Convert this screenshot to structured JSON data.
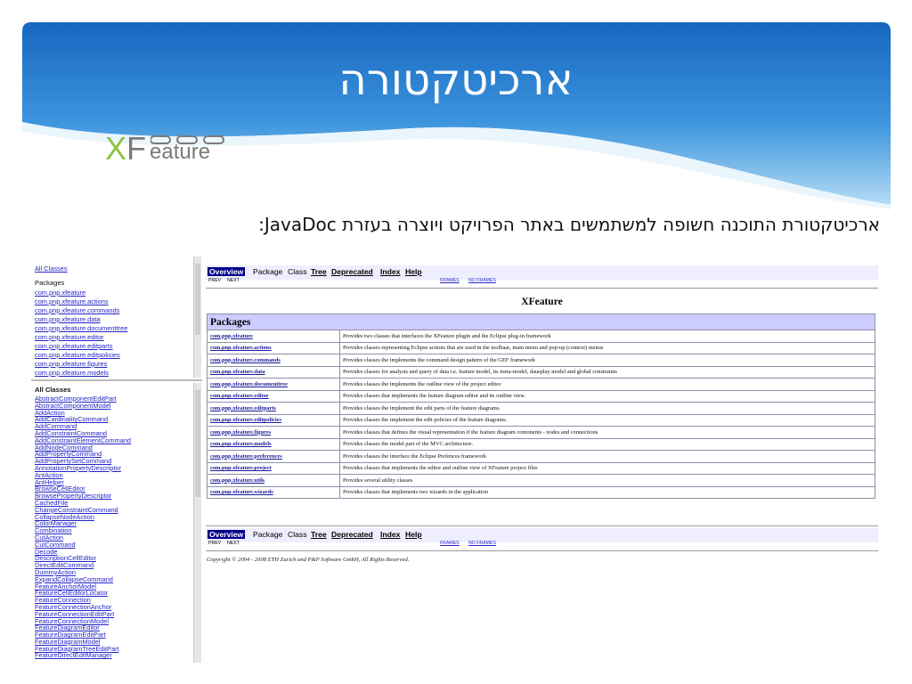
{
  "slide": {
    "title": "ארכיטקטורה",
    "subtitle": "ארכיטקטורת התוכנה חשופה למשתמשים באתר הפרויקט ויוצרה בעזרת JavaDoc:",
    "logo_text": "XFeature",
    "logo_x": "X",
    "logo_f": "F",
    "logo_rest": "eature",
    "colors": {
      "header_top": "#1a6fc4",
      "header_bottom": "#9ccdf0",
      "logo_green": "#8cc63f",
      "logo_gray": "#7a7a7a"
    }
  },
  "packages_frame": {
    "all_classes_link": "All Classes",
    "packages_label": "Packages",
    "items": [
      "com.pnp.xfeature",
      "com.pnp.xfeature.actions",
      "com.pnp.xfeature.commands",
      "com.pnp.xfeature.data",
      "com.pnp.xfeature.documenttree",
      "com.pnp.xfeature.editor",
      "com.pnp.xfeature.editparts",
      "com.pnp.xfeature.editpolicies",
      "com.pnp.xfeature.figures",
      "com.pnp.xfeature.models"
    ]
  },
  "classes_frame": {
    "heading": "All Classes",
    "items": [
      "AbstractComponentEditPart",
      "AbstractComponentModel",
      "AddAction",
      "AddCardinalityCommand",
      "AddCommand",
      "AddConstraintCommand",
      "AddConstraintElementCommand",
      "AddNodeCommand",
      "AddPropertyCommand",
      "AddPropertySetCommand",
      "AnnotationPropertyDescriptor",
      "AntAction",
      "AntHelper",
      "BrowseCellEditor",
      "BrowsePropertyDescriptor",
      "CachedFile",
      "ChangeConstraintCommand",
      "CollapseNodeAction",
      "ColorManager",
      "Combination",
      "CutAction",
      "CutCommand",
      "Decode",
      "DescriptionCellEditor",
      "DirectEditCommand",
      "DummyAction",
      "ExpandCollapseCommand",
      "FeatureAnchorModel",
      "FeatureCellEditorLocator",
      "FeatureConnection",
      "FeatureConnectionAnchor",
      "FeatureConnectionEditPart",
      "FeatureConnectionModel",
      "FeatureDiagramEditor",
      "FeatureDiagramEditPart",
      "FeatureDiagramModel",
      "FeatureDiagramTreeEditPart",
      "FeatureDirectEditManager"
    ]
  },
  "navbar": {
    "overview": "Overview",
    "package": "Package",
    "class": "Class",
    "tree": "Tree",
    "deprecated": "Deprecated",
    "index": "Index",
    "help": "Help",
    "prev": "PREV",
    "next": "NEXT",
    "frames": "FRAMES",
    "no_frames": "NO FRAMES"
  },
  "overview": {
    "title": "XFeature",
    "table_heading": "Packages",
    "rows": [
      {
        "name": "com.pnp.xfeature",
        "desc": "Provides two classes that interfaces the XFeature plugin and the Eclipse plug-in framework"
      },
      {
        "name": "com.pnp.xfeature.actions",
        "desc": "Provides classes representing Eclipse actions that are used in the toolbaar, main menu and pop-up (context) menus"
      },
      {
        "name": "com.pnp.xfeature.commands",
        "desc": "Provides classes the implements the command design pattern of the GEF framework"
      },
      {
        "name": "com.pnp.xfeature.data",
        "desc": "Provides classes for analysis and query of data i.e. feature model, its meta-model, dausplay model and global constraints"
      },
      {
        "name": "com.pnp.xfeature.documenttree",
        "desc": "Provides classes the implements the outline view of the project editor"
      },
      {
        "name": "com.pnp.xfeature.editor",
        "desc": "Provides classes that implements the feature diagram editor and its outline view."
      },
      {
        "name": "com.pnp.xfeature.editparts",
        "desc": "Provides classes the implement the edit parts of the feature diagrams."
      },
      {
        "name": "com.pnp.xfeature.editpolicies",
        "desc": "Provides classes the implement the edit policies of the feature diagrams."
      },
      {
        "name": "com.pnp.xfeature.figures",
        "desc": "Provides classes that defines the visual representation if the feature diagram comonents - nodes and connections"
      },
      {
        "name": "com.pnp.xfeature.models",
        "desc": "Provides classes the model part of the MVC architecture."
      },
      {
        "name": "com.pnp.xfeature.preferences",
        "desc": "Provides classes the interface the Eclipse Prefences framework"
      },
      {
        "name": "com.pnp.xfeature.project",
        "desc": "Provides classes that implements the editor and outline view of XFeature project files"
      },
      {
        "name": "com.pnp.xfeature.utils",
        "desc": "Provides several utility classes"
      },
      {
        "name": "com.pnp.xfeature.wizards",
        "desc": "Provides classes that implements two wizards in the application"
      }
    ],
    "copyright": "Copyright © 2004 - 2008 ETH Zurich and P&P Software GmbH, All Rights Reserved."
  }
}
